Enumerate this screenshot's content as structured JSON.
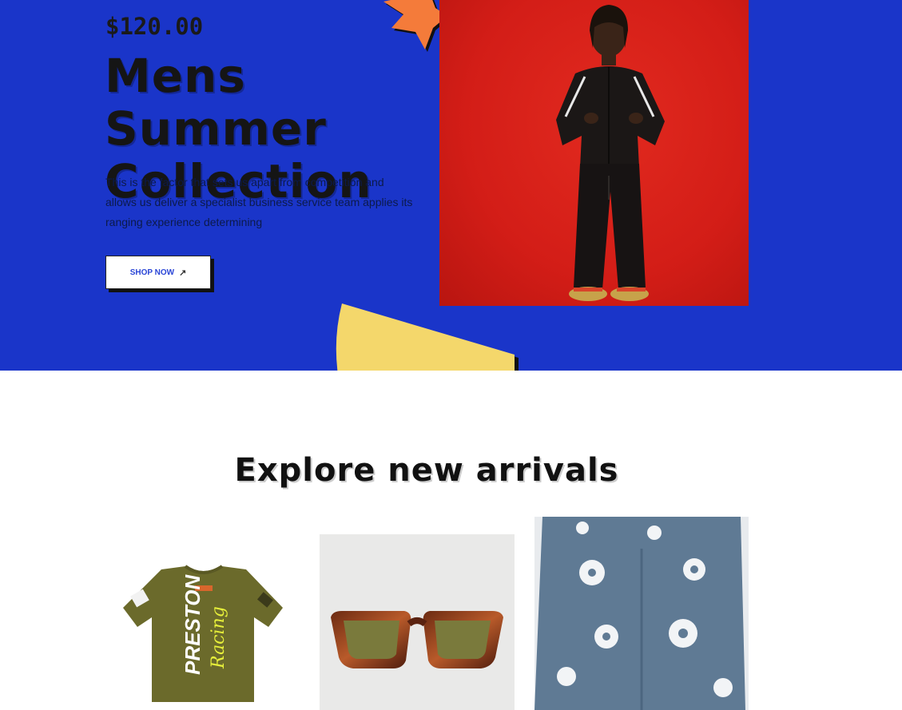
{
  "hero": {
    "price": "$120.00",
    "title": "Mens Summer Collection",
    "description": "This is the factor that sets us apart from competition and allows us deliver a specialist business service team applies its ranging experience determining",
    "cta_label": "SHOP NOW",
    "cta_icon": "arrow-up-right-icon",
    "image_subject": "man in black tracksuit on red background"
  },
  "arrivals": {
    "title": "Explore new arrivals",
    "products": [
      {
        "image": "olive green racing t-shirt",
        "shirt_print_1": "PRESTON",
        "shirt_print_2": "Racing"
      },
      {
        "image": "tortoiseshell sunglasses"
      },
      {
        "image": "floral denim jeans"
      }
    ]
  },
  "colors": {
    "hero_bg": "#1a35c9",
    "accent_orange": "#f47b3a",
    "accent_yellow": "#f4d76b",
    "photo_red": "#d31d17"
  }
}
